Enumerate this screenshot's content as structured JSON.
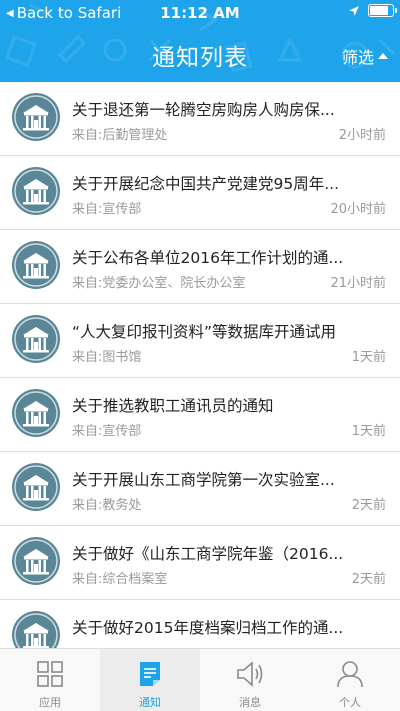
{
  "status_bar": {
    "back_label": "Back to Safari",
    "time": "11:12 AM",
    "battery_level": 0.9
  },
  "nav": {
    "title": "通知列表",
    "filter_label": "筛选"
  },
  "notifications": [
    {
      "title": "关于退还第一轮腾空房购房人购房保...",
      "source": "来自:后勤管理处",
      "time": "2小时前"
    },
    {
      "title": "关于开展纪念中国共产党建党95周年...",
      "source": "来自:宣传部",
      "time": "20小时前"
    },
    {
      "title": "关于公布各单位2016年工作计划的通...",
      "source": "来自:党委办公室、院长办公室",
      "time": "21小时前"
    },
    {
      "title": "“人大复印报刊资料”等数据库开通试用",
      "source": "来自:图书馆",
      "time": "1天前"
    },
    {
      "title": "关于推选教职工通讯员的通知",
      "source": "来自:宣传部",
      "time": "1天前"
    },
    {
      "title": "关于开展山东工商学院第一次实验室...",
      "source": "来自:教务处",
      "time": "2天前"
    },
    {
      "title": "关于做好《山东工商学院年鉴（2016...",
      "source": "来自:综合档案室",
      "time": "2天前"
    },
    {
      "title": "关于做好2015年度档案归档工作的通...",
      "source": "",
      "time": ""
    }
  ],
  "tabs": [
    {
      "label": "应用",
      "icon": "grid-icon",
      "active": false
    },
    {
      "label": "通知",
      "icon": "document-icon",
      "active": true
    },
    {
      "label": "消息",
      "icon": "speaker-icon",
      "active": false
    },
    {
      "label": "个人",
      "icon": "person-icon",
      "active": false
    }
  ],
  "colors": {
    "primary": "#1ea4ea",
    "avatar_bg": "#5a8797",
    "secondary_text": "#9a9a9a"
  }
}
